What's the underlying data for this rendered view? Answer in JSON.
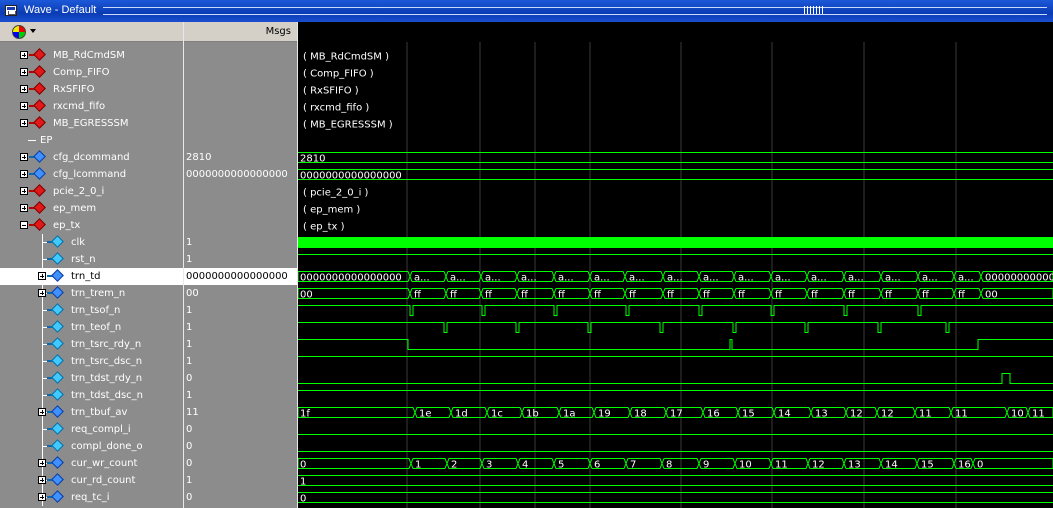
{
  "window": {
    "title": "Wave - Default"
  },
  "header": {
    "msgs_label": "Msgs"
  },
  "colors": {
    "wave": "#00ff00",
    "grid": "#3a3a3a",
    "text": "#ffffff",
    "selected": "#ffffff",
    "pane": "#8c8c8c"
  },
  "signals": [
    {
      "name": "MB_RdCmdSM",
      "value": "",
      "icon": "red-diamond-icon",
      "expander": "plus",
      "indent": 0
    },
    {
      "name": "Comp_FIFO",
      "value": "",
      "icon": "red-diamond-icon",
      "expander": "plus",
      "indent": 0
    },
    {
      "name": "RxSFIFO",
      "value": "",
      "icon": "red-diamond-icon",
      "expander": "plus",
      "indent": 0
    },
    {
      "name": "rxcmd_fifo",
      "value": "",
      "icon": "red-diamond-icon",
      "expander": "plus",
      "indent": 0
    },
    {
      "name": "MB_EGRESSSM",
      "value": "",
      "icon": "red-diamond-icon",
      "expander": "plus",
      "indent": 0
    },
    {
      "name": "EP",
      "value": "",
      "divider": true
    },
    {
      "name": "cfg_dcommand",
      "value": "2810",
      "icon": "blue-diamond-icon",
      "expander": "plus",
      "indent": 0
    },
    {
      "name": "cfg_lcommand",
      "value": "0000000000000000",
      "icon": "blue-diamond-icon",
      "expander": "plus",
      "indent": 0
    },
    {
      "name": "pcie_2_0_i",
      "value": "",
      "icon": "red-diamond-icon",
      "expander": "plus",
      "indent": 0
    },
    {
      "name": "ep_mem",
      "value": "",
      "icon": "red-diamond-icon",
      "expander": "plus",
      "indent": 0
    },
    {
      "name": "ep_tx",
      "value": "",
      "icon": "red-diamond-icon",
      "expander": "minus",
      "indent": 0
    },
    {
      "name": "clk",
      "value": "1",
      "icon": "cyan-diamond-icon",
      "expander": "",
      "indent": 1
    },
    {
      "name": "rst_n",
      "value": "1",
      "icon": "cyan-diamond-icon",
      "expander": "",
      "indent": 1
    },
    {
      "name": "trn_td",
      "value": "0000000000000000",
      "icon": "blue-diamond-icon",
      "expander": "plus",
      "indent": 1,
      "selected": true
    },
    {
      "name": "trn_trem_n",
      "value": "00",
      "icon": "blue-diamond-icon",
      "expander": "plus",
      "indent": 1
    },
    {
      "name": "trn_tsof_n",
      "value": "1",
      "icon": "cyan-diamond-icon",
      "expander": "",
      "indent": 1
    },
    {
      "name": "trn_teof_n",
      "value": "1",
      "icon": "cyan-diamond-icon",
      "expander": "",
      "indent": 1
    },
    {
      "name": "trn_tsrc_rdy_n",
      "value": "1",
      "icon": "cyan-diamond-icon",
      "expander": "",
      "indent": 1
    },
    {
      "name": "trn_tsrc_dsc_n",
      "value": "1",
      "icon": "cyan-diamond-icon",
      "expander": "",
      "indent": 1
    },
    {
      "name": "trn_tdst_rdy_n",
      "value": "0",
      "icon": "cyan-diamond-icon",
      "expander": "",
      "indent": 1
    },
    {
      "name": "trn_tdst_dsc_n",
      "value": "1",
      "icon": "cyan-diamond-icon",
      "expander": "",
      "indent": 1
    },
    {
      "name": "trn_tbuf_av",
      "value": "11",
      "icon": "blue-diamond-icon",
      "expander": "plus",
      "indent": 1
    },
    {
      "name": "req_compl_i",
      "value": "0",
      "icon": "cyan-diamond-icon",
      "expander": "",
      "indent": 1
    },
    {
      "name": "compl_done_o",
      "value": "0",
      "icon": "cyan-diamond-icon",
      "expander": "",
      "indent": 1
    },
    {
      "name": "cur_wr_count",
      "value": "0",
      "icon": "blue-diamond-icon",
      "expander": "plus",
      "indent": 1
    },
    {
      "name": "cur_rd_count",
      "value": "1",
      "icon": "blue-diamond-icon",
      "expander": "plus",
      "indent": 1
    },
    {
      "name": "req_tc_i",
      "value": "0",
      "icon": "blue-diamond-icon",
      "expander": "plus",
      "indent": 1
    }
  ],
  "waves": {
    "instance_labels": [
      "( MB_RdCmdSM )",
      "( Comp_FIFO )",
      "( RxSFIFO )",
      "( rxcmd_fifo )",
      "( MB_EGRESSSM )",
      "( pcie_2_0_i )",
      "( ep_mem )",
      "( ep_tx )"
    ],
    "cfg_dcommand": "2810",
    "cfg_lcommand": "0000000000000000",
    "trn_td": [
      "0000000000000000",
      "a...",
      "a...",
      "a...",
      "a...",
      "a...",
      "a...",
      "a...",
      "a...",
      "a...",
      "a...",
      "a...",
      "a...",
      "a...",
      "a...",
      "a...",
      "a...",
      "0000000000000000"
    ],
    "trn_trem_n": [
      "00",
      "ff",
      "ff",
      "ff",
      "ff",
      "ff",
      "ff",
      "ff",
      "ff",
      "ff",
      "ff",
      "ff",
      "ff",
      "ff",
      "ff",
      "ff",
      "ff",
      "00"
    ],
    "trn_tbuf_av": [
      "1f",
      "1e",
      "1d",
      "1c",
      "1b",
      "1a",
      "19",
      "18",
      "17",
      "16",
      "15",
      "14",
      "13",
      "12",
      "12",
      "11",
      "11",
      "10",
      "11"
    ],
    "cur_wr_count": [
      "0",
      "1",
      "2",
      "3",
      "4",
      "5",
      "6",
      "7",
      "8",
      "9",
      "10",
      "11",
      "12",
      "13",
      "14",
      "15",
      "16",
      "0"
    ],
    "cur_rd_count": "1",
    "req_tc_i": "0"
  }
}
